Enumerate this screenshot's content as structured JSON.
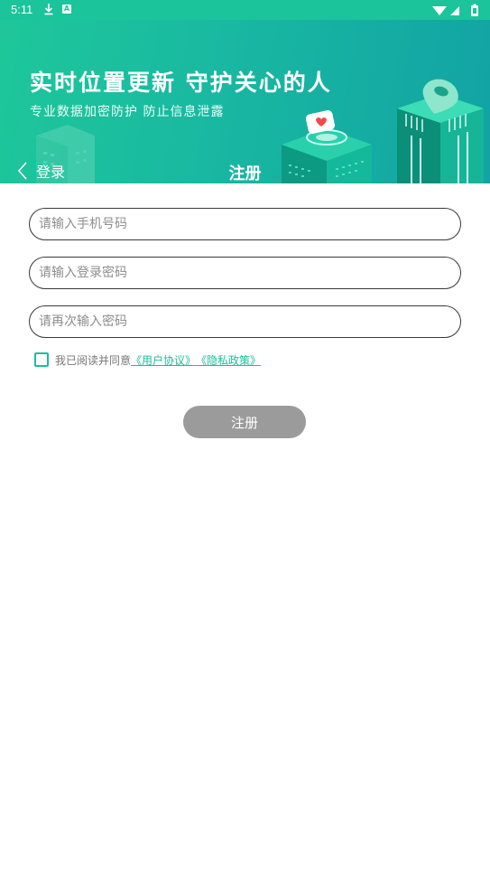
{
  "status_bar": {
    "time": "5:11",
    "badge": "A"
  },
  "banner": {
    "title": "实时位置更新 守护关心的人",
    "subtitle": "专业数据加密防护 防止信息泄露"
  },
  "nav": {
    "back_label": "登录",
    "title": "注册"
  },
  "form": {
    "phone_placeholder": "请输入手机号码",
    "password_placeholder": "请输入登录密码",
    "confirm_placeholder": "请再次输入密码",
    "agree_text": "我已阅读并同意",
    "user_agreement": "《用户协议》",
    "privacy_policy": "《隐私政策》",
    "submit_label": "注册"
  },
  "colors": {
    "brand": "#19bf9b",
    "button_disabled": "#9b9b9b"
  },
  "icons": [
    "download-icon",
    "a-badge-icon",
    "wifi-icon",
    "signal-icon",
    "battery-icon",
    "chevron-left-icon",
    "map-pin-icon",
    "heart-chat-icon"
  ]
}
